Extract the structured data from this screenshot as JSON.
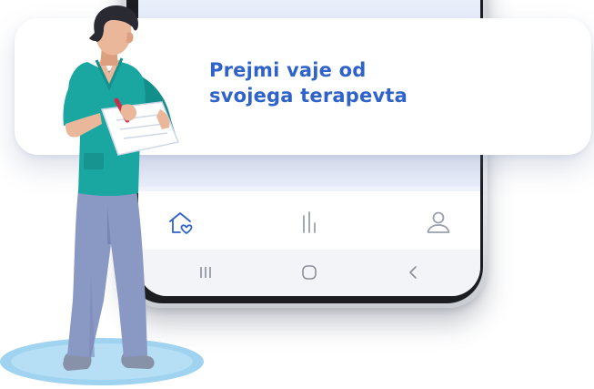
{
  "callout": {
    "line1": "Prejmi vaje od",
    "line2": "svojega terapevta"
  },
  "tabbar": {
    "items": [
      {
        "icon": "home-heart-icon",
        "active": true
      },
      {
        "icon": "stats-bars-icon",
        "active": false
      },
      {
        "icon": "profile-icon",
        "active": false
      }
    ]
  },
  "system_nav": {
    "items": [
      {
        "icon": "recent-apps-icon"
      },
      {
        "icon": "home-pill-icon"
      },
      {
        "icon": "back-chevron-icon"
      }
    ]
  },
  "colors": {
    "accent": "#2f63c9",
    "icon_inactive": "#9aa0ab",
    "scrubs": "#1ba7a1",
    "pants": "#8a98c4",
    "floor_ellipse": "#9fd3f0"
  }
}
